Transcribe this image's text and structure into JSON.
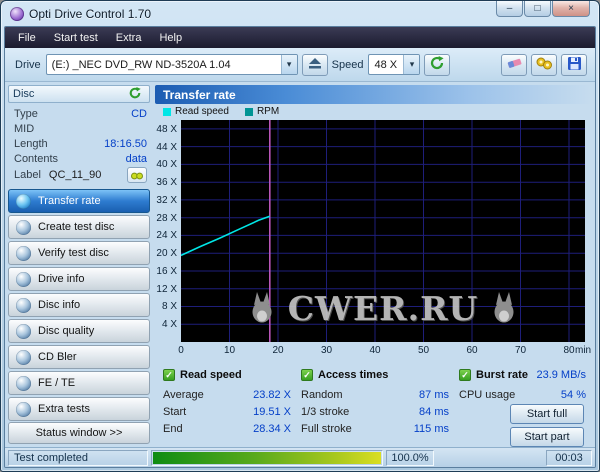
{
  "window": {
    "title": "Opti Drive Control 1.70",
    "minimize": "–",
    "maximize": "□",
    "close": "×"
  },
  "menu": {
    "items": [
      {
        "label": "File"
      },
      {
        "label": "Start test"
      },
      {
        "label": "Extra"
      },
      {
        "label": "Help"
      }
    ]
  },
  "toolbar": {
    "drive_label": "Drive",
    "drive_value": "(E:)  _NEC DVD_RW ND-3520A 1.04",
    "speed_label": "Speed",
    "speed_value": "48 X"
  },
  "sidebar": {
    "disc_header": "Disc",
    "info": [
      {
        "label": "Type",
        "value": "CD"
      },
      {
        "label": "MID",
        "value": ""
      },
      {
        "label": "Length",
        "value": "18:16.50"
      },
      {
        "label": "Contents",
        "value": "data"
      },
      {
        "label": "Label",
        "value": "QC_11_90"
      }
    ],
    "buttons": [
      {
        "label": "Transfer rate",
        "selected": true
      },
      {
        "label": "Create test disc",
        "selected": false
      },
      {
        "label": "Verify test disc",
        "selected": false
      },
      {
        "label": "Drive info",
        "selected": false
      },
      {
        "label": "Disc info",
        "selected": false
      },
      {
        "label": "Disc quality",
        "selected": false
      },
      {
        "label": "CD Bler",
        "selected": false
      },
      {
        "label": "FE / TE",
        "selected": false
      },
      {
        "label": "Extra tests",
        "selected": false
      }
    ],
    "status_window": "Status window >>"
  },
  "main": {
    "header": "Transfer rate",
    "legend": [
      {
        "label": "Read speed",
        "color": "#00e6e6"
      },
      {
        "label": "RPM",
        "color": "#009494"
      }
    ],
    "watermark": "CWER.RU"
  },
  "results": {
    "read_speed": {
      "title": "Read speed",
      "rows": [
        {
          "label": "Average",
          "value": "23.82 X"
        },
        {
          "label": "Start",
          "value": "19.51 X"
        },
        {
          "label": "End",
          "value": "28.34 X"
        }
      ]
    },
    "access_times": {
      "title": "Access times",
      "rows": [
        {
          "label": "Random",
          "value": "87 ms"
        },
        {
          "label": "1/3 stroke",
          "value": "84 ms"
        },
        {
          "label": "Full stroke",
          "value": "115 ms"
        }
      ]
    },
    "burst": {
      "title": "Burst rate",
      "value": "23.9 MB/s",
      "cpu_label": "CPU usage",
      "cpu_value": "54 %",
      "start_full": "Start full",
      "start_part": "Start part"
    }
  },
  "statusbar": {
    "text": "Test completed",
    "progress_percent": 100,
    "progress_label": "100.0%",
    "time": "00:03"
  },
  "chart_data": {
    "type": "line",
    "title": "Transfer rate",
    "xlabel": "min",
    "ylabel": "X",
    "xlim": [
      0,
      80
    ],
    "ylim": [
      0,
      50
    ],
    "x_ticks": [
      0,
      10,
      20,
      30,
      40,
      50,
      60,
      70,
      80
    ],
    "y_ticks": [
      4,
      8,
      12,
      16,
      20,
      24,
      28,
      32,
      36,
      40,
      44,
      48
    ],
    "y_tick_suffix": " X",
    "grid": true,
    "grid_color": "#1e1e7a",
    "background": "#000000",
    "legend_position": "top-left",
    "series": [
      {
        "name": "Read speed",
        "color": "#00e6e6",
        "x": [
          0,
          4,
          8,
          12,
          16,
          18.3
        ],
        "y": [
          19.51,
          21.5,
          23.4,
          25.4,
          27.4,
          28.34
        ]
      },
      {
        "name": "RPM",
        "color": "#009494",
        "x": [],
        "y": []
      }
    ],
    "end_marker": {
      "x": 18.3,
      "color": "#c45ac4"
    }
  }
}
